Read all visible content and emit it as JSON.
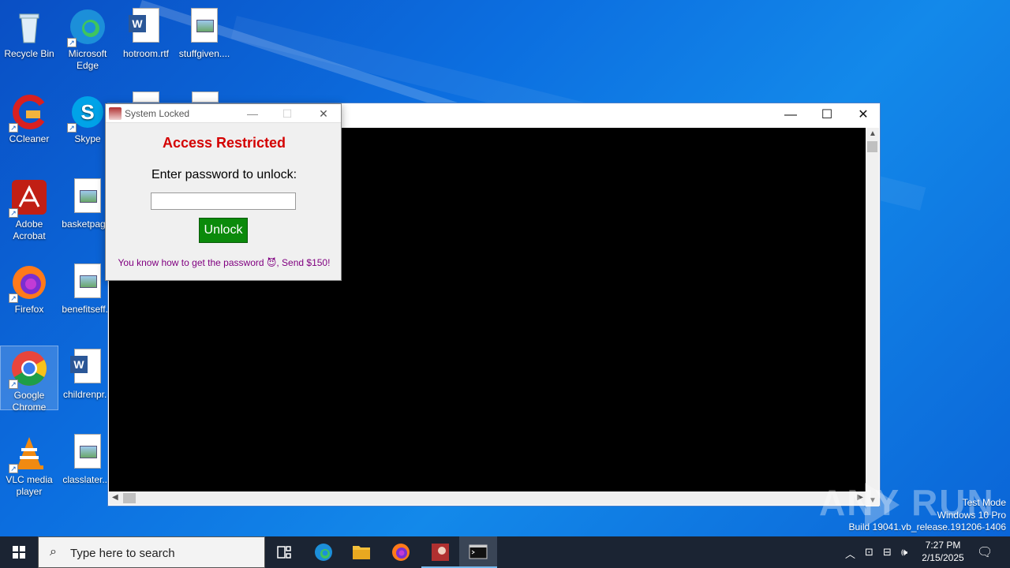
{
  "desktop": {
    "icons": [
      {
        "label": "Recycle Bin"
      },
      {
        "label": "Microsoft Edge"
      },
      {
        "label": "hotroom.rtf"
      },
      {
        "label": "stuffgiven...."
      },
      {
        "label": "CCleaner"
      },
      {
        "label": "Skype"
      },
      {
        "label": "Adobe Acrobat"
      },
      {
        "label": "basketpag..."
      },
      {
        "label": "Firefox"
      },
      {
        "label": "benefitseff..."
      },
      {
        "label": "Google Chrome"
      },
      {
        "label": "childrenpr..."
      },
      {
        "label": "VLC media player"
      },
      {
        "label": "classlater...."
      }
    ]
  },
  "lock_dialog": {
    "title": "System Locked",
    "heading": "Access Restricted",
    "prompt": "Enter password to unlock:",
    "password_value": "",
    "unlock_label": "Unlock",
    "note": "You know how to get the password 😈, Send $150!"
  },
  "watermark": {
    "text": "ANY RUN",
    "lines": [
      "Test Mode",
      "Windows 10 Pro",
      "Build 19041.vb_release.191206-1406"
    ]
  },
  "taskbar": {
    "search_placeholder": "Type here to search",
    "time": "7:27 PM",
    "date": "2/15/2025"
  },
  "colors": {
    "heading": "#d40000",
    "unlock_button": "#0b8a0b",
    "note_text": "#800080",
    "console_bg": "#000000"
  }
}
